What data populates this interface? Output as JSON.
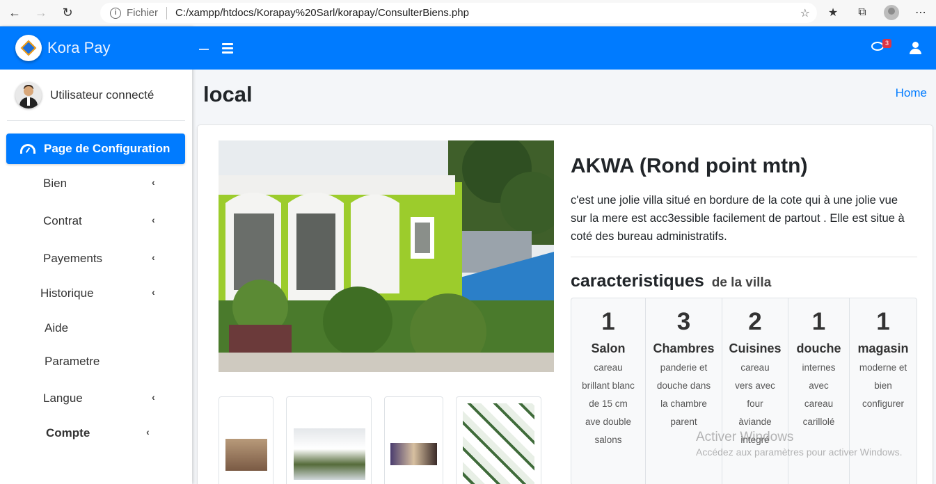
{
  "browser": {
    "scheme": "Fichier",
    "url": "C:/xampp/htdocs/Korapay%20Sarl/korapay/ConsulterBiens.php"
  },
  "brand": {
    "name": "Kora Pay",
    "color": "#007bff"
  },
  "user": {
    "name": "Utilisateur connecté"
  },
  "sidebar": {
    "active": "Page de Configuration",
    "items": [
      {
        "label": "Bien",
        "has_children": true
      },
      {
        "label": "Contrat",
        "has_children": true
      },
      {
        "label": "Payements",
        "has_children": true
      },
      {
        "label": "Historique",
        "has_children": true
      },
      {
        "label": "Aide",
        "has_children": false
      },
      {
        "label": "Parametre",
        "has_children": false
      },
      {
        "label": "Langue",
        "has_children": true
      },
      {
        "label": "Compte",
        "has_children": true
      }
    ],
    "chevron": "‹"
  },
  "header": {
    "messages_badge": "3"
  },
  "page": {
    "title": "local",
    "breadcrumb": "Home"
  },
  "property": {
    "title": "AKWA (Rond point mtn)",
    "description": "c'est une jolie villa situé en bordure de la cote qui à une jolie vue sur la mere est acc3essible facilement de partout . Elle est situe à coté des bureau administratifs.",
    "characteristics_title": "caracteristiques",
    "characteristics_subtitle": "de la villa",
    "features": [
      {
        "count": "1",
        "name": "Salon",
        "desc": "careau brillant blanc de 15 cm ave double salons"
      },
      {
        "count": "3",
        "name": "Chambres",
        "desc": "panderie et douche dans la chambre parent"
      },
      {
        "count": "2",
        "name": "Cuisines",
        "desc": "careau vers avec four àviande integré"
      },
      {
        "count": "1",
        "name": "douche",
        "desc": "internes avec careau carillolé"
      },
      {
        "count": "1",
        "name": "magasin",
        "desc": "moderne et bien configurer"
      }
    ]
  },
  "watermark": {
    "line1": "Activer Windows",
    "line2": "Accédez aux paramètres pour activer Windows."
  }
}
